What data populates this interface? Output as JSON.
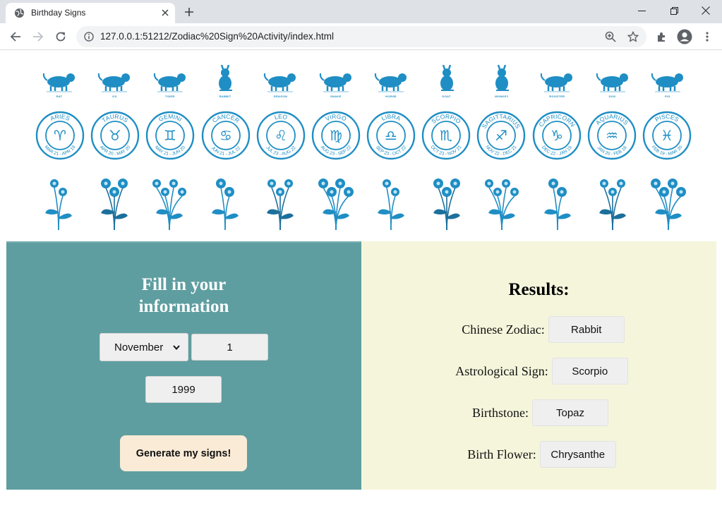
{
  "browser": {
    "tab_title": "Birthday Signs",
    "url": "127.0.0.1:51212/Zodiac%20Sign%20Activity/index.html"
  },
  "accent_color": "#1f8ec4",
  "chinese_zodiac": [
    {
      "label": "RAT",
      "icon": "rat-icon"
    },
    {
      "label": "OX",
      "icon": "ox-icon"
    },
    {
      "label": "TIGER",
      "icon": "tiger-icon"
    },
    {
      "label": "RABBIT",
      "icon": "rabbit-icon"
    },
    {
      "label": "DRAGON",
      "icon": "dragon-icon"
    },
    {
      "label": "SNAKE",
      "icon": "snake-icon"
    },
    {
      "label": "HORSE",
      "icon": "horse-icon"
    },
    {
      "label": "GOAT",
      "icon": "goat-icon"
    },
    {
      "label": "MONKEY",
      "icon": "monkey-icon"
    },
    {
      "label": "ROOSTER",
      "icon": "rooster-icon"
    },
    {
      "label": "DOG",
      "icon": "dog-icon"
    },
    {
      "label": "PIG",
      "icon": "pig-icon"
    }
  ],
  "astro_signs": [
    {
      "name": "ARIES",
      "dates": "MAR 21 - APR 19",
      "glyph": "♈"
    },
    {
      "name": "TAURUS",
      "dates": "APR 20 - MAY 20",
      "glyph": "♉"
    },
    {
      "name": "GEMINI",
      "dates": "MAY 21 - JUN 20",
      "glyph": "♊"
    },
    {
      "name": "CANCER",
      "dates": "JUN 21 - JUL 22",
      "glyph": "♋"
    },
    {
      "name": "LEO",
      "dates": "JUL 23 - AUG 22",
      "glyph": "♌"
    },
    {
      "name": "VIRGO",
      "dates": "AUG 23 - SEP 22",
      "glyph": "♍"
    },
    {
      "name": "LIBRA",
      "dates": "SEP 23 - OCT 22",
      "glyph": "♎"
    },
    {
      "name": "SCORPIO",
      "dates": "OCT 23 - NOV 21",
      "glyph": "♏"
    },
    {
      "name": "SAGITTARIUS",
      "dates": "NOV 22 - DEC 21",
      "glyph": "♐"
    },
    {
      "name": "CAPRICORN",
      "dates": "DEC 22 - JAN 19",
      "glyph": "♑"
    },
    {
      "name": "AQUARIUS",
      "dates": "JAN 20 - FEB 18",
      "glyph": "♒"
    },
    {
      "name": "PISCES",
      "dates": "FEB 19 - MAR 20",
      "glyph": "♓"
    }
  ],
  "form": {
    "title_line1": "Fill in your",
    "title_line2": "information",
    "month": "November",
    "day": "1",
    "year": "1999",
    "button_label": "Generate my signs!"
  },
  "results": {
    "title": "Results:",
    "chinese_zodiac_label": "Chinese Zodiac:",
    "chinese_zodiac_value": "Rabbit",
    "astrological_label": "Astrological Sign:",
    "astrological_value": "Scorpio",
    "birthstone_label": "Birthstone:",
    "birthstone_value": "Topaz",
    "birth_flower_label": "Birth Flower:",
    "birth_flower_value": "Chrysanthe"
  }
}
